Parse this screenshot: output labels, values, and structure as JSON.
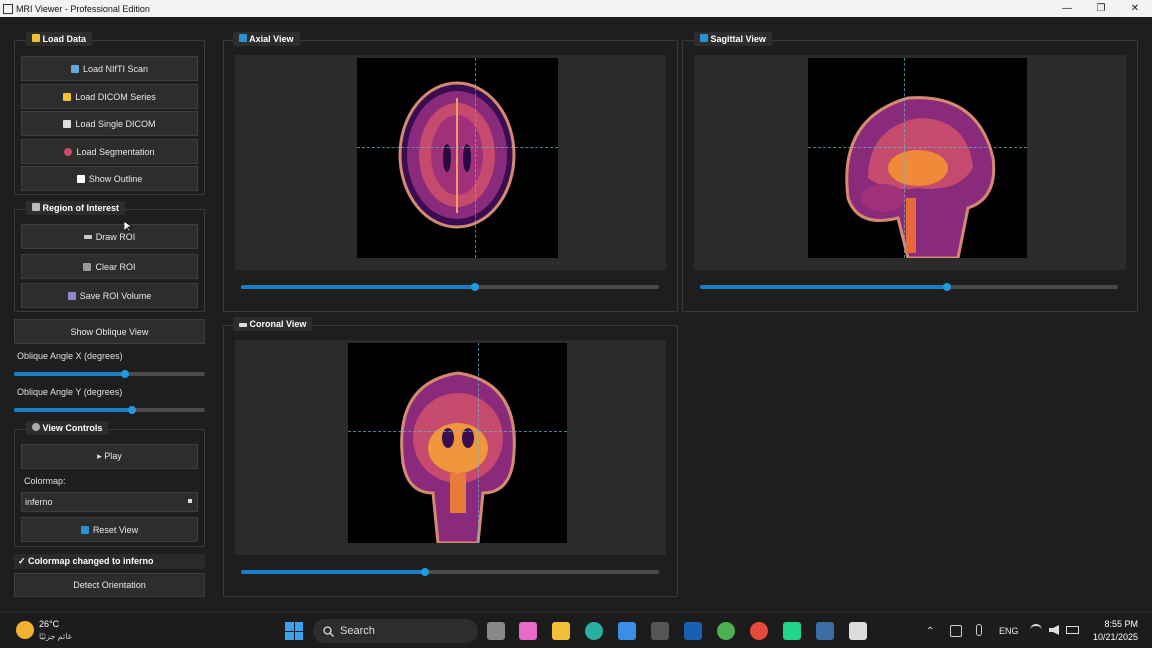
{
  "window": {
    "title": "MRI Viewer - Professional Edition",
    "minimize": "—",
    "maximize": "❐",
    "close": "✕"
  },
  "load": {
    "title": "Load Data",
    "buttons": [
      "Load NIfTI Scan",
      "Load DICOM Series",
      "Load Single DICOM",
      "Load Segmentation",
      "Show Outline"
    ]
  },
  "roi": {
    "title": "Region of Interest",
    "buttons": [
      "Draw ROI",
      "Clear ROI",
      "Save ROI Volume"
    ]
  },
  "oblique": {
    "button": "Show Oblique View",
    "angle_x_label": "Oblique Angle X (degrees)",
    "angle_x": 0.58,
    "angle_y_label": "Oblique Angle Y (degrees)",
    "angle_y": 0.62
  },
  "view_controls": {
    "title": "View Controls",
    "play": "▸ Play",
    "colormap_label": "Colormap:",
    "colormap_value": "inferno",
    "reset": "Reset View"
  },
  "status": "✓ Colormap changed to inferno",
  "detect": "Detect Orientation",
  "views": {
    "axial": {
      "title": "Axial View",
      "slice": 0.56
    },
    "sagittal": {
      "title": "Sagittal View",
      "slice": 0.59
    },
    "coronal": {
      "title": "Coronal View",
      "slice": 0.44
    }
  },
  "taskbar": {
    "temp": "26°C",
    "weather": "غائم جزئيًا",
    "search": "Search",
    "lang": "ENG",
    "time": "8:55 PM",
    "date": "10/21/2025"
  }
}
